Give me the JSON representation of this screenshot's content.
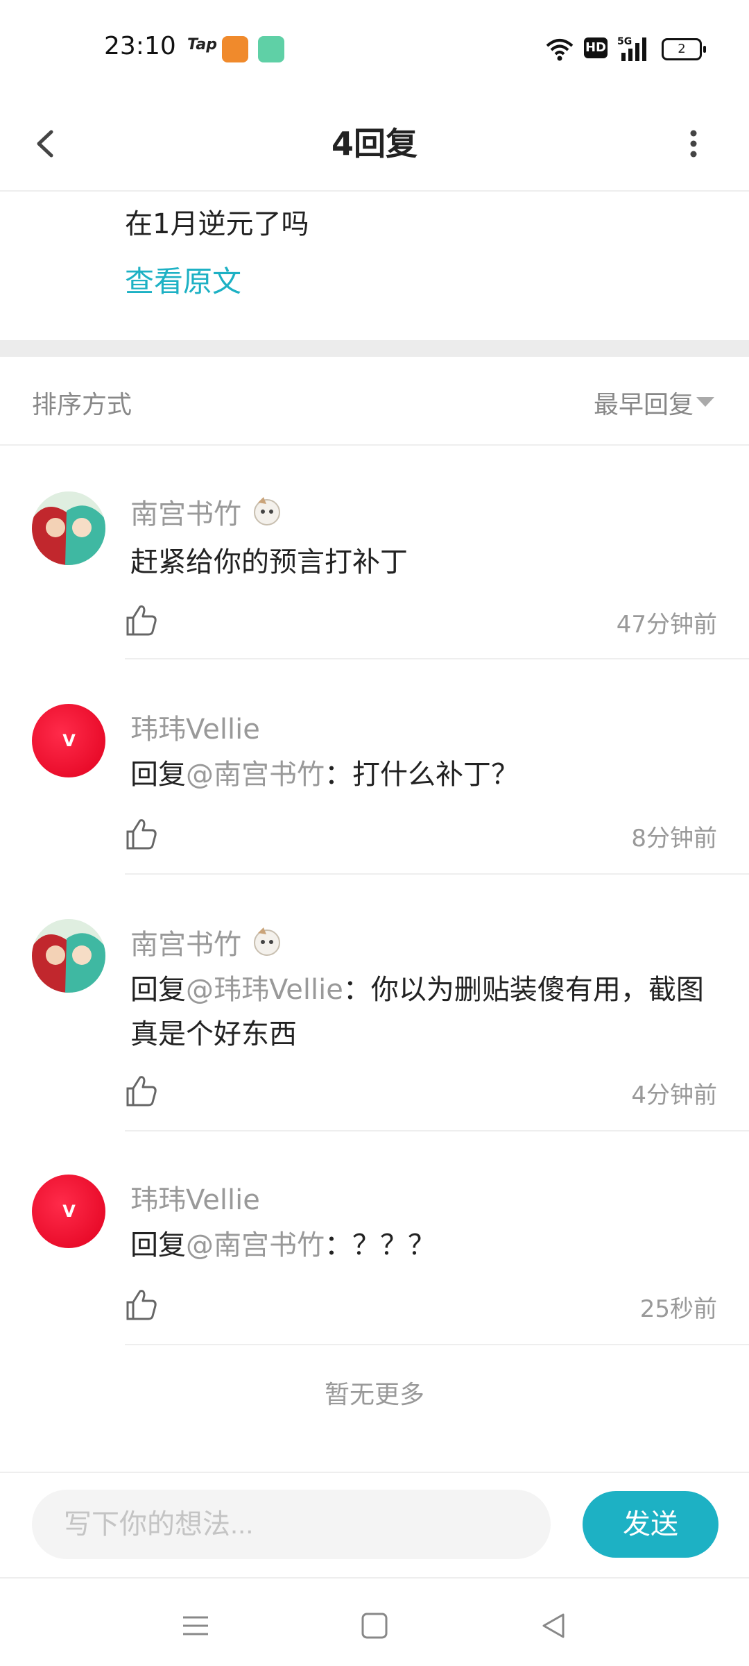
{
  "status_bar": {
    "time": "23:10",
    "app_tap": "Tap",
    "network": "5G",
    "hd": "HD",
    "battery": "2"
  },
  "header": {
    "title": "4回复",
    "back_icon": "chevron-left-icon",
    "more_icon": "more-vertical-icon"
  },
  "original": {
    "text": "在1月逆元了吗",
    "view_link": "查看原文"
  },
  "sort": {
    "label": "排序方式",
    "value": "最早回复"
  },
  "comments": [
    {
      "author": "南宫书竹",
      "reply_prefix": "",
      "mention": "",
      "text": "赶紧给你的预言打补丁",
      "time": "47分钟前"
    },
    {
      "author": "玮玮Vellie",
      "reply_prefix": "回复",
      "mention": "@南宫书竹",
      "text": "：打什么补丁？",
      "time": "8分钟前"
    },
    {
      "author": "南宫书竹",
      "reply_prefix": "回复",
      "mention": "@玮玮Vellie",
      "text": "：你以为删贴装傻有用，截图真是个好东西",
      "time": "4分钟前"
    },
    {
      "author": "玮玮Vellie",
      "reply_prefix": "回复",
      "mention": "@南宫书竹",
      "text": "：？？？",
      "time": "25秒前"
    }
  ],
  "footer": {
    "no_more": "暂无更多"
  },
  "composer": {
    "placeholder": "写下你的想法...",
    "send_label": "发送"
  },
  "colors": {
    "accent": "#1db1c4",
    "muted": "#999999",
    "text": "#222222"
  }
}
